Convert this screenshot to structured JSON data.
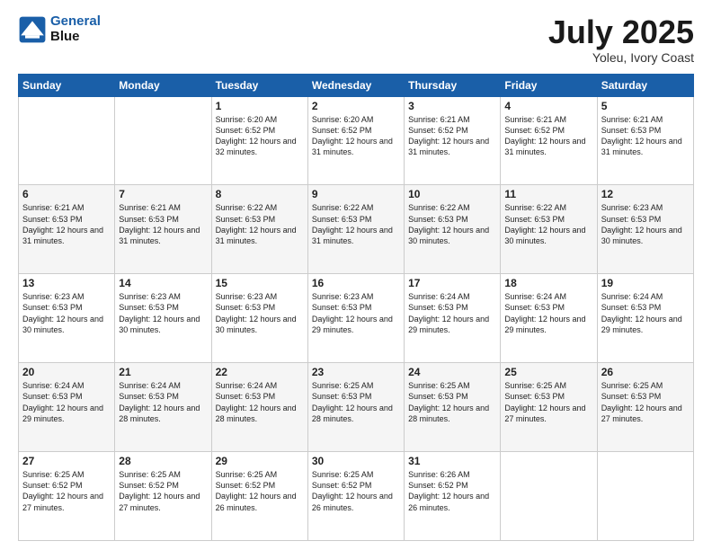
{
  "logo": {
    "line1": "General",
    "line2": "Blue"
  },
  "title": "July 2025",
  "location": "Yoleu, Ivory Coast",
  "days_header": [
    "Sunday",
    "Monday",
    "Tuesday",
    "Wednesday",
    "Thursday",
    "Friday",
    "Saturday"
  ],
  "weeks": [
    {
      "row_class": "row-normal",
      "days": [
        {
          "num": "",
          "info": ""
        },
        {
          "num": "",
          "info": ""
        },
        {
          "num": "1",
          "info": "Sunrise: 6:20 AM\nSunset: 6:52 PM\nDaylight: 12 hours and 32 minutes."
        },
        {
          "num": "2",
          "info": "Sunrise: 6:20 AM\nSunset: 6:52 PM\nDaylight: 12 hours and 31 minutes."
        },
        {
          "num": "3",
          "info": "Sunrise: 6:21 AM\nSunset: 6:52 PM\nDaylight: 12 hours and 31 minutes."
        },
        {
          "num": "4",
          "info": "Sunrise: 6:21 AM\nSunset: 6:52 PM\nDaylight: 12 hours and 31 minutes."
        },
        {
          "num": "5",
          "info": "Sunrise: 6:21 AM\nSunset: 6:53 PM\nDaylight: 12 hours and 31 minutes."
        }
      ]
    },
    {
      "row_class": "row-alt",
      "days": [
        {
          "num": "6",
          "info": "Sunrise: 6:21 AM\nSunset: 6:53 PM\nDaylight: 12 hours and 31 minutes."
        },
        {
          "num": "7",
          "info": "Sunrise: 6:21 AM\nSunset: 6:53 PM\nDaylight: 12 hours and 31 minutes."
        },
        {
          "num": "8",
          "info": "Sunrise: 6:22 AM\nSunset: 6:53 PM\nDaylight: 12 hours and 31 minutes."
        },
        {
          "num": "9",
          "info": "Sunrise: 6:22 AM\nSunset: 6:53 PM\nDaylight: 12 hours and 31 minutes."
        },
        {
          "num": "10",
          "info": "Sunrise: 6:22 AM\nSunset: 6:53 PM\nDaylight: 12 hours and 30 minutes."
        },
        {
          "num": "11",
          "info": "Sunrise: 6:22 AM\nSunset: 6:53 PM\nDaylight: 12 hours and 30 minutes."
        },
        {
          "num": "12",
          "info": "Sunrise: 6:23 AM\nSunset: 6:53 PM\nDaylight: 12 hours and 30 minutes."
        }
      ]
    },
    {
      "row_class": "row-normal",
      "days": [
        {
          "num": "13",
          "info": "Sunrise: 6:23 AM\nSunset: 6:53 PM\nDaylight: 12 hours and 30 minutes."
        },
        {
          "num": "14",
          "info": "Sunrise: 6:23 AM\nSunset: 6:53 PM\nDaylight: 12 hours and 30 minutes."
        },
        {
          "num": "15",
          "info": "Sunrise: 6:23 AM\nSunset: 6:53 PM\nDaylight: 12 hours and 30 minutes."
        },
        {
          "num": "16",
          "info": "Sunrise: 6:23 AM\nSunset: 6:53 PM\nDaylight: 12 hours and 29 minutes."
        },
        {
          "num": "17",
          "info": "Sunrise: 6:24 AM\nSunset: 6:53 PM\nDaylight: 12 hours and 29 minutes."
        },
        {
          "num": "18",
          "info": "Sunrise: 6:24 AM\nSunset: 6:53 PM\nDaylight: 12 hours and 29 minutes."
        },
        {
          "num": "19",
          "info": "Sunrise: 6:24 AM\nSunset: 6:53 PM\nDaylight: 12 hours and 29 minutes."
        }
      ]
    },
    {
      "row_class": "row-alt",
      "days": [
        {
          "num": "20",
          "info": "Sunrise: 6:24 AM\nSunset: 6:53 PM\nDaylight: 12 hours and 29 minutes."
        },
        {
          "num": "21",
          "info": "Sunrise: 6:24 AM\nSunset: 6:53 PM\nDaylight: 12 hours and 28 minutes."
        },
        {
          "num": "22",
          "info": "Sunrise: 6:24 AM\nSunset: 6:53 PM\nDaylight: 12 hours and 28 minutes."
        },
        {
          "num": "23",
          "info": "Sunrise: 6:25 AM\nSunset: 6:53 PM\nDaylight: 12 hours and 28 minutes."
        },
        {
          "num": "24",
          "info": "Sunrise: 6:25 AM\nSunset: 6:53 PM\nDaylight: 12 hours and 28 minutes."
        },
        {
          "num": "25",
          "info": "Sunrise: 6:25 AM\nSunset: 6:53 PM\nDaylight: 12 hours and 27 minutes."
        },
        {
          "num": "26",
          "info": "Sunrise: 6:25 AM\nSunset: 6:53 PM\nDaylight: 12 hours and 27 minutes."
        }
      ]
    },
    {
      "row_class": "row-normal",
      "days": [
        {
          "num": "27",
          "info": "Sunrise: 6:25 AM\nSunset: 6:52 PM\nDaylight: 12 hours and 27 minutes."
        },
        {
          "num": "28",
          "info": "Sunrise: 6:25 AM\nSunset: 6:52 PM\nDaylight: 12 hours and 27 minutes."
        },
        {
          "num": "29",
          "info": "Sunrise: 6:25 AM\nSunset: 6:52 PM\nDaylight: 12 hours and 26 minutes."
        },
        {
          "num": "30",
          "info": "Sunrise: 6:25 AM\nSunset: 6:52 PM\nDaylight: 12 hours and 26 minutes."
        },
        {
          "num": "31",
          "info": "Sunrise: 6:26 AM\nSunset: 6:52 PM\nDaylight: 12 hours and 26 minutes."
        },
        {
          "num": "",
          "info": ""
        },
        {
          "num": "",
          "info": ""
        }
      ]
    }
  ]
}
